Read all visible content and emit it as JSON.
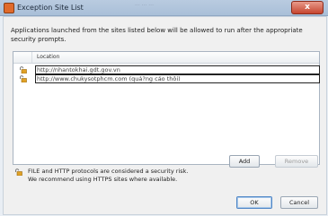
{
  "window": {
    "title": "Exception Site List",
    "background_text": "... ... ...",
    "close_glyph": "x"
  },
  "description": "Applications launched from the sites listed below will be allowed to run after the appropriate security prompts.",
  "table": {
    "column_label": "Location",
    "rows": [
      {
        "location": "http://nhantokhai.gdt.gov.vn"
      },
      {
        "location": "http://www.chukysotphcm.com (quả?ng cáo thôi)"
      }
    ]
  },
  "buttons": {
    "add": "Add",
    "remove": "Remove",
    "ok": "OK",
    "cancel": "Cancel"
  },
  "warning": {
    "line1": "FILE and HTTP protocols are considered a security risk.",
    "line2": "We recommend using HTTPS sites where available."
  },
  "colors": {
    "lock_body": "#e0a126",
    "lock_shackle": "#7b7b7b",
    "title_bar": "#b9cbe0",
    "close_button": "#c6452f"
  }
}
